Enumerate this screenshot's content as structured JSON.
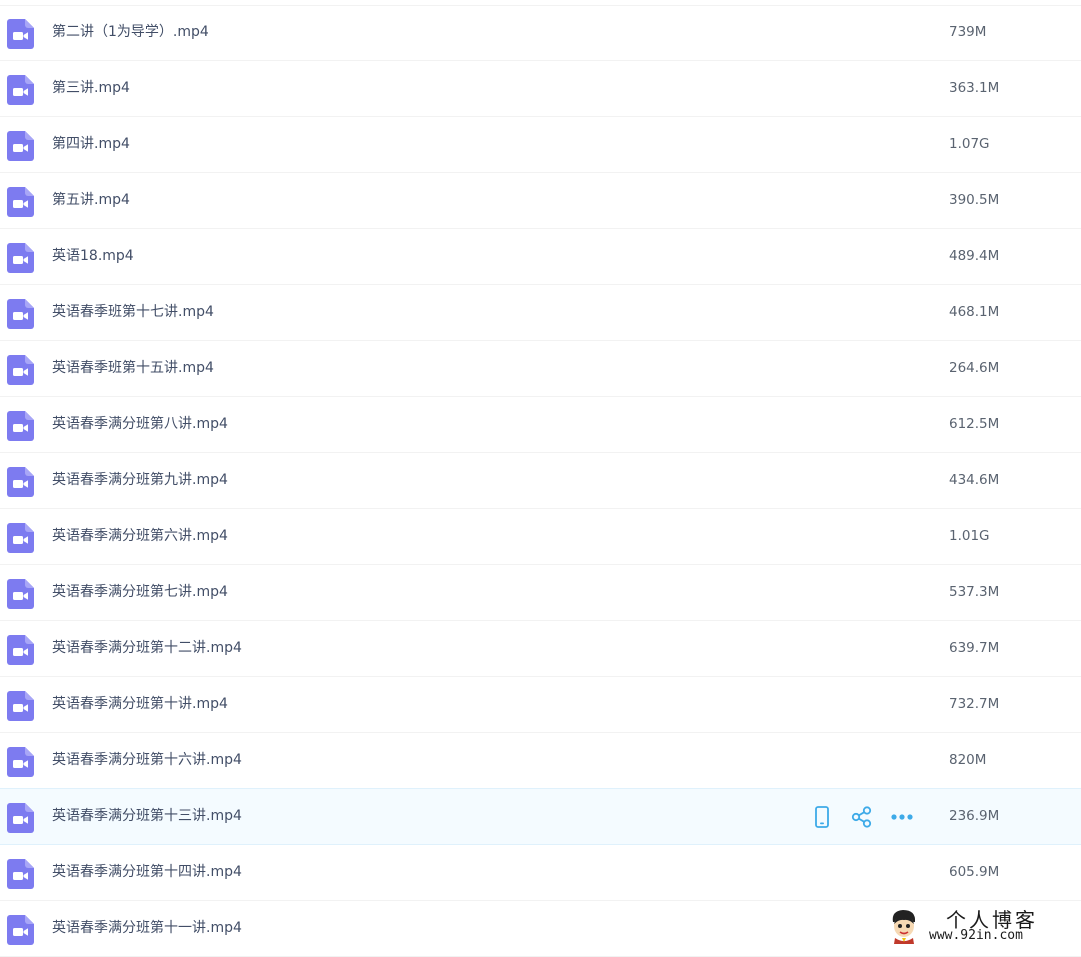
{
  "files": [
    {
      "name": "第二讲（1为导学）.mp4",
      "size": "739M"
    },
    {
      "name": "第三讲.mp4",
      "size": "363.1M"
    },
    {
      "name": "第四讲.mp4",
      "size": "1.07G"
    },
    {
      "name": "第五讲.mp4",
      "size": "390.5M"
    },
    {
      "name": "英语18.mp4",
      "size": "489.4M"
    },
    {
      "name": "英语春季班第十七讲.mp4",
      "size": "468.1M"
    },
    {
      "name": "英语春季班第十五讲.mp4",
      "size": "264.6M"
    },
    {
      "name": "英语春季满分班第八讲.mp4",
      "size": "612.5M"
    },
    {
      "name": "英语春季满分班第九讲.mp4",
      "size": "434.6M"
    },
    {
      "name": "英语春季满分班第六讲.mp4",
      "size": "1.01G"
    },
    {
      "name": "英语春季满分班第七讲.mp4",
      "size": "537.3M"
    },
    {
      "name": "英语春季满分班第十二讲.mp4",
      "size": "639.7M"
    },
    {
      "name": "英语春季满分班第十讲.mp4",
      "size": "732.7M"
    },
    {
      "name": "英语春季满分班第十六讲.mp4",
      "size": "820M"
    },
    {
      "name": "英语春季满分班第十三讲.mp4",
      "size": "236.9M"
    },
    {
      "name": "英语春季满分班第十四讲.mp4",
      "size": "605.9M"
    },
    {
      "name": "英语春季满分班第十一讲.mp4",
      "size": ""
    }
  ],
  "hovered_row_index": 14,
  "row_actions": [
    {
      "icon": "mobile-icon"
    },
    {
      "icon": "share-icon"
    },
    {
      "icon": "more-icon"
    }
  ],
  "colors": {
    "video_icon": "#7d7bf0",
    "action_icon": "#3daae8",
    "hover_bg": "#f4fbff",
    "name_text": "#424e67",
    "size_text": "#5a6370"
  },
  "watermark": {
    "title": "个人博客",
    "url": "www.92in.com"
  }
}
